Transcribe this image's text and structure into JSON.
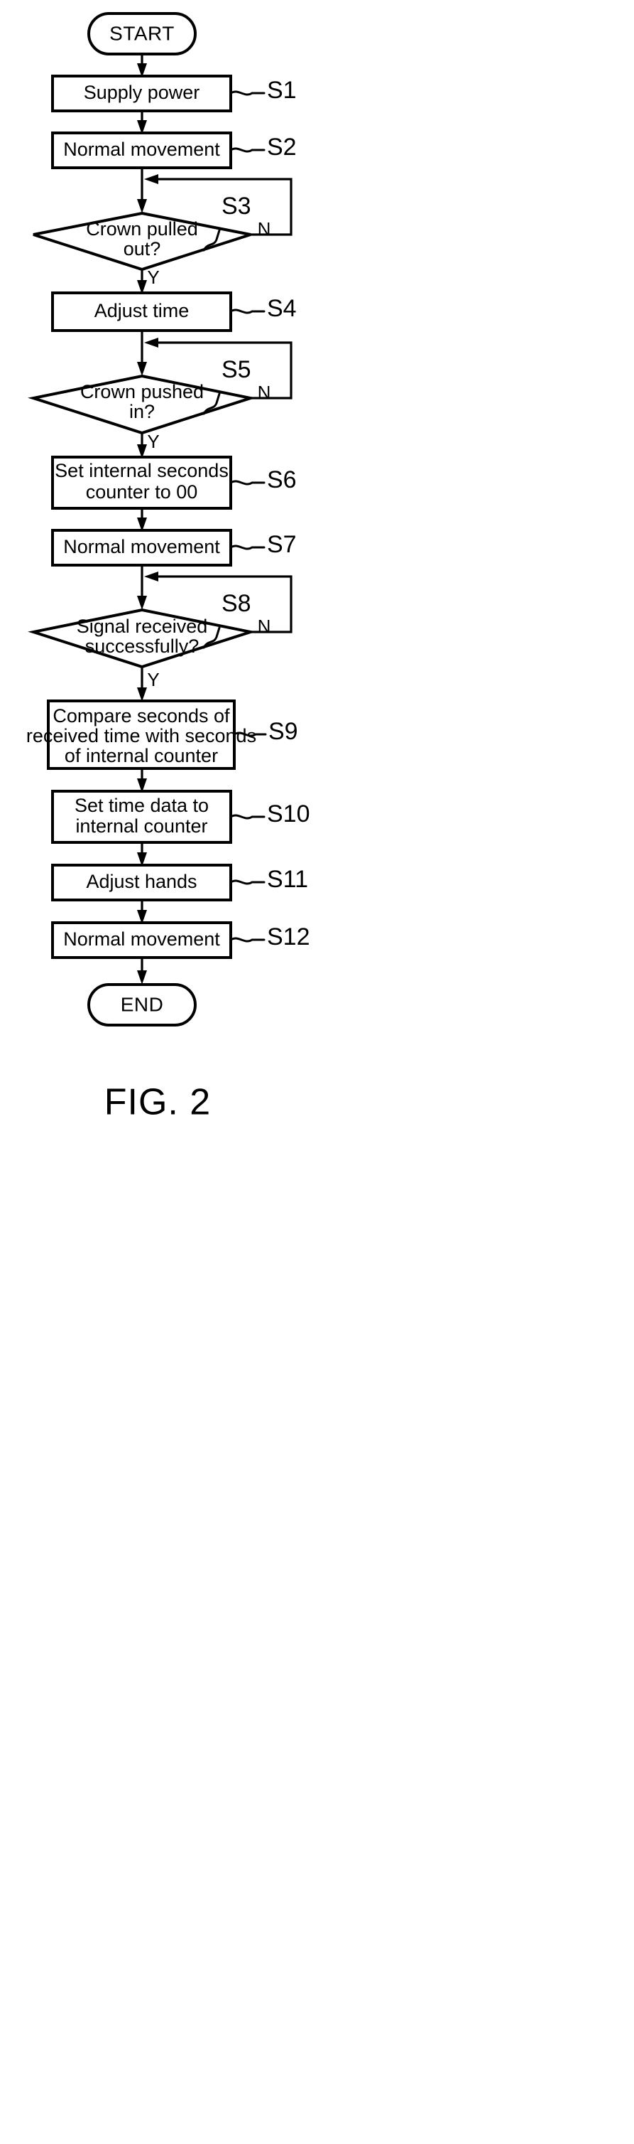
{
  "figure": {
    "caption": "FIG. 2",
    "background_color": "#ffffff",
    "stroke_color": "#000000"
  },
  "chart_data": {
    "type": "diagram",
    "title": "FIG. 2",
    "diagram_kind": "flowchart",
    "orientation": "top-to-bottom",
    "nodes": [
      {
        "id": "start",
        "shape": "terminator",
        "text": "START",
        "step": null
      },
      {
        "id": "s1",
        "shape": "process",
        "text": "Supply power",
        "step": "S1"
      },
      {
        "id": "s2",
        "shape": "process",
        "text": "Normal movement",
        "step": "S2"
      },
      {
        "id": "s3",
        "shape": "decision",
        "text": "Crown pulled out?",
        "step": "S3",
        "yes": "Y",
        "no": "N"
      },
      {
        "id": "s4",
        "shape": "process",
        "text": "Adjust time",
        "step": "S4"
      },
      {
        "id": "s5",
        "shape": "decision",
        "text": "Crown pushed in?",
        "step": "S5",
        "yes": "Y",
        "no": "N"
      },
      {
        "id": "s6",
        "shape": "process",
        "text": "Set internal seconds counter to 00",
        "step": "S6"
      },
      {
        "id": "s7",
        "shape": "process",
        "text": "Normal movement",
        "step": "S7"
      },
      {
        "id": "s8",
        "shape": "decision",
        "text": "Signal received successfully?",
        "step": "S8",
        "yes": "Y",
        "no": "N"
      },
      {
        "id": "s9",
        "shape": "process",
        "text": "Compare seconds of received time with seconds of internal counter",
        "step": "S9"
      },
      {
        "id": "s10",
        "shape": "process",
        "text": "Set time data to internal counter",
        "step": "S10"
      },
      {
        "id": "s11",
        "shape": "process",
        "text": "Adjust hands",
        "step": "S11"
      },
      {
        "id": "s12",
        "shape": "process",
        "text": "Normal movement",
        "step": "S12"
      },
      {
        "id": "end",
        "shape": "terminator",
        "text": "END",
        "step": null
      }
    ],
    "edges": [
      {
        "from": "start",
        "to": "s1",
        "label": ""
      },
      {
        "from": "s1",
        "to": "s2",
        "label": ""
      },
      {
        "from": "s2",
        "to": "s3",
        "label": ""
      },
      {
        "from": "s3",
        "to": "s4",
        "label": "Y"
      },
      {
        "from": "s3",
        "to": "s3",
        "label": "N",
        "kind": "loop-back"
      },
      {
        "from": "s4",
        "to": "s5",
        "label": ""
      },
      {
        "from": "s5",
        "to": "s6",
        "label": "Y"
      },
      {
        "from": "s5",
        "to": "s5",
        "label": "N",
        "kind": "loop-back"
      },
      {
        "from": "s6",
        "to": "s7",
        "label": ""
      },
      {
        "from": "s7",
        "to": "s8",
        "label": ""
      },
      {
        "from": "s8",
        "to": "s9",
        "label": "Y"
      },
      {
        "from": "s8",
        "to": "s8",
        "label": "N",
        "kind": "loop-back"
      },
      {
        "from": "s9",
        "to": "s10",
        "label": ""
      },
      {
        "from": "s10",
        "to": "s11",
        "label": ""
      },
      {
        "from": "s11",
        "to": "s12",
        "label": ""
      },
      {
        "from": "s12",
        "to": "end",
        "label": ""
      }
    ]
  },
  "nodes": {
    "start": {
      "text": "START"
    },
    "s1": {
      "text": "Supply power",
      "step": "S1"
    },
    "s2": {
      "text": "Normal movement",
      "step": "S2"
    },
    "s3": {
      "line1": "Crown pulled",
      "line2": "out?",
      "step": "S3",
      "no": "N",
      "yes": "Y"
    },
    "s4": {
      "text": "Adjust time",
      "step": "S4"
    },
    "s5": {
      "line1": "Crown pushed",
      "line2": "in?",
      "step": "S5",
      "no": "N",
      "yes": "Y"
    },
    "s6": {
      "line1": "Set internal seconds",
      "line2": "counter to 00",
      "step": "S6"
    },
    "s7": {
      "text": "Normal movement",
      "step": "S7"
    },
    "s8": {
      "line1": "Signal received",
      "line2": "successfully?",
      "step": "S8",
      "no": "N",
      "yes": "Y"
    },
    "s9": {
      "line1": "Compare seconds of",
      "line2": "received time with seconds",
      "line3": "of internal counter",
      "step": "S9"
    },
    "s10": {
      "line1": "Set time data to",
      "line2": "internal counter",
      "step": "S10"
    },
    "s11": {
      "text": "Adjust hands",
      "step": "S11"
    },
    "s12": {
      "text": "Normal movement",
      "step": "S12"
    },
    "end": {
      "text": "END"
    }
  }
}
